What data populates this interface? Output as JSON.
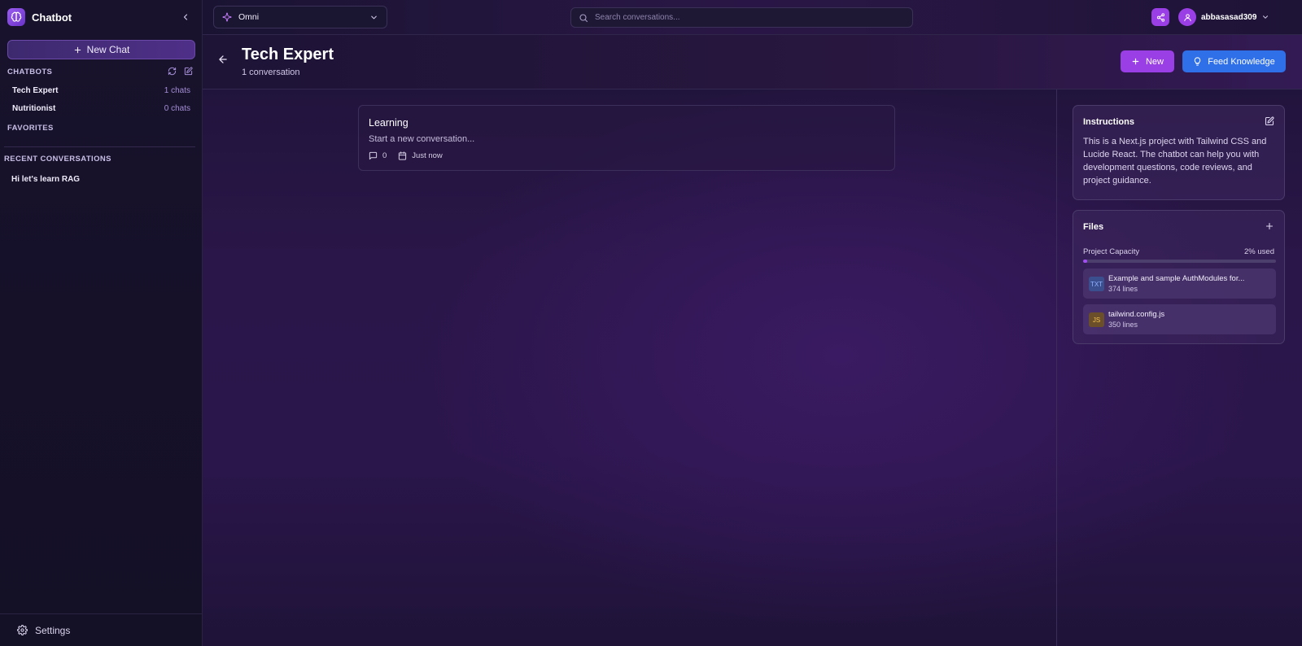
{
  "app": {
    "title": "Chatbot"
  },
  "sidebar": {
    "new_chat_label": "New Chat",
    "chatbots_label": "CHATBOTS",
    "chatbots": [
      {
        "name": "Tech Expert",
        "count": "1 chats"
      },
      {
        "name": "Nutritionist",
        "count": "0 chats"
      }
    ],
    "favorites_label": "FAVORITES",
    "recent_label": "RECENT CONVERSATIONS",
    "recent": [
      {
        "title": "Hi let's learn RAG"
      }
    ],
    "settings_label": "Settings"
  },
  "topbar": {
    "model": "Omni",
    "search_placeholder": "Search conversations...",
    "username": "abbasasad309"
  },
  "page": {
    "title": "Tech Expert",
    "subtitle": "1 conversation",
    "new_label": "New",
    "feed_label": "Feed Knowledge"
  },
  "conversations": [
    {
      "title": "Learning",
      "preview": "Start a new conversation...",
      "messages": "0",
      "time": "Just now"
    }
  ],
  "instructions": {
    "title": "Instructions",
    "text": "This is a Next.js project with Tailwind CSS and Lucide React. The chatbot can help you with development questions, code reviews, and project guidance."
  },
  "files": {
    "title": "Files",
    "capacity_label": "Project Capacity",
    "capacity_value": "2% used",
    "capacity_percent": 2,
    "items": [
      {
        "badge": "TXT",
        "name": "Example and sample AuthModules for...",
        "lines": "374 lines"
      },
      {
        "badge": "JS",
        "name": "tailwind.config.js",
        "lines": "350 lines"
      }
    ]
  },
  "colors": {
    "accent_purple": "#9a3ee6",
    "accent_blue": "#2f6fe8",
    "txt_badge_bg": "#3b4f8f",
    "txt_badge_fg": "#8fb2ff",
    "js_badge_bg": "#6b4f2a",
    "js_badge_fg": "#f2c14e"
  }
}
